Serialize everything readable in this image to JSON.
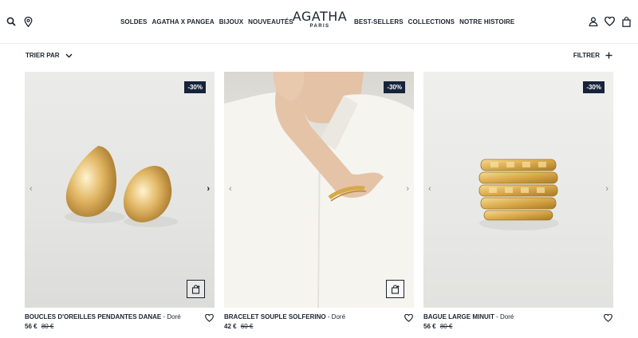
{
  "header": {
    "logo": "AGATHA",
    "logo_sub": "PARIS",
    "nav_left": [
      "SOLDES",
      "AGATHA X PANGEA",
      "BIJOUX",
      "NOUVEAUTÉS"
    ],
    "nav_right": [
      "BEST-SELLERS",
      "COLLECTIONS",
      "NOTRE HISTOIRE"
    ],
    "icons_left": [
      "search-icon",
      "location-pin-icon"
    ],
    "icons_right": [
      "account-icon",
      "heart-icon",
      "bag-icon"
    ]
  },
  "toolbar": {
    "sort_label": "TRIER PAR",
    "filter_label": "FILTRER"
  },
  "products": [
    {
      "name": "BOUCLES D'OREILLES PENDANTES DANAE",
      "color": "- Doré",
      "price": "56 €",
      "old_price": "80 €",
      "discount": "-30%"
    },
    {
      "name": "BRACELET SOUPLE SOLFERINO",
      "color": "- Doré",
      "price": "42 €",
      "old_price": "60 €",
      "discount": "-30%"
    },
    {
      "name": "BAGUE LARGE MINUIT",
      "color": "- Doré",
      "price": "56 €",
      "old_price": "80 €",
      "discount": "-30%"
    }
  ],
  "colors": {
    "badge": "#16233a",
    "text": "#1b2430",
    "gold": "#d9ad4c"
  }
}
